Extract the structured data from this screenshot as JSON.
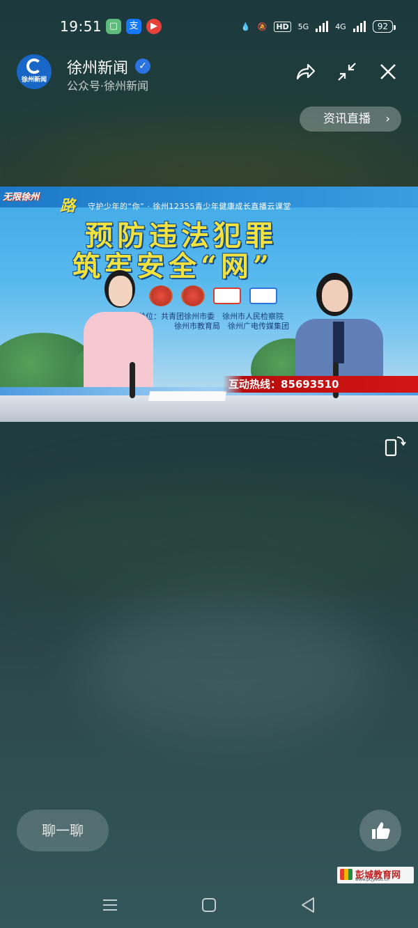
{
  "status_bar": {
    "time": "19:51",
    "hd_label": "HD",
    "network_5g": "5G",
    "network_4g": "4G",
    "battery": "92"
  },
  "header": {
    "avatar_text": "徐州新闻",
    "account_name": "徐州新闻",
    "account_sub": "公众号·徐州新闻",
    "verified_mark": "✓"
  },
  "live_button": {
    "label": "资讯直播",
    "chevron": "›"
  },
  "video": {
    "logo_text": "无限徐州",
    "road_char": "路",
    "subtitle": "守护少年的“你” · 徐州12355青少年健康成长直播云课堂",
    "title_line1": "预防违法犯罪",
    "title_line2": "筑牢安全“网”",
    "organizer_line1": "主办单位：共青团徐州市委　徐州市人民检察院",
    "organizer_line2": "徐州市教育局　徐州广电传媒集团",
    "hotline": "互动热线：85693510"
  },
  "bottom": {
    "chat_label": "聊一聊",
    "watermark_name": "彭城教育网",
    "watermark_url": "www.pcjyedu.cn"
  },
  "colors": {
    "accent_blue": "#2a73e0",
    "hotline_red": "#d51515",
    "title_yellow": "#f2e23f"
  }
}
